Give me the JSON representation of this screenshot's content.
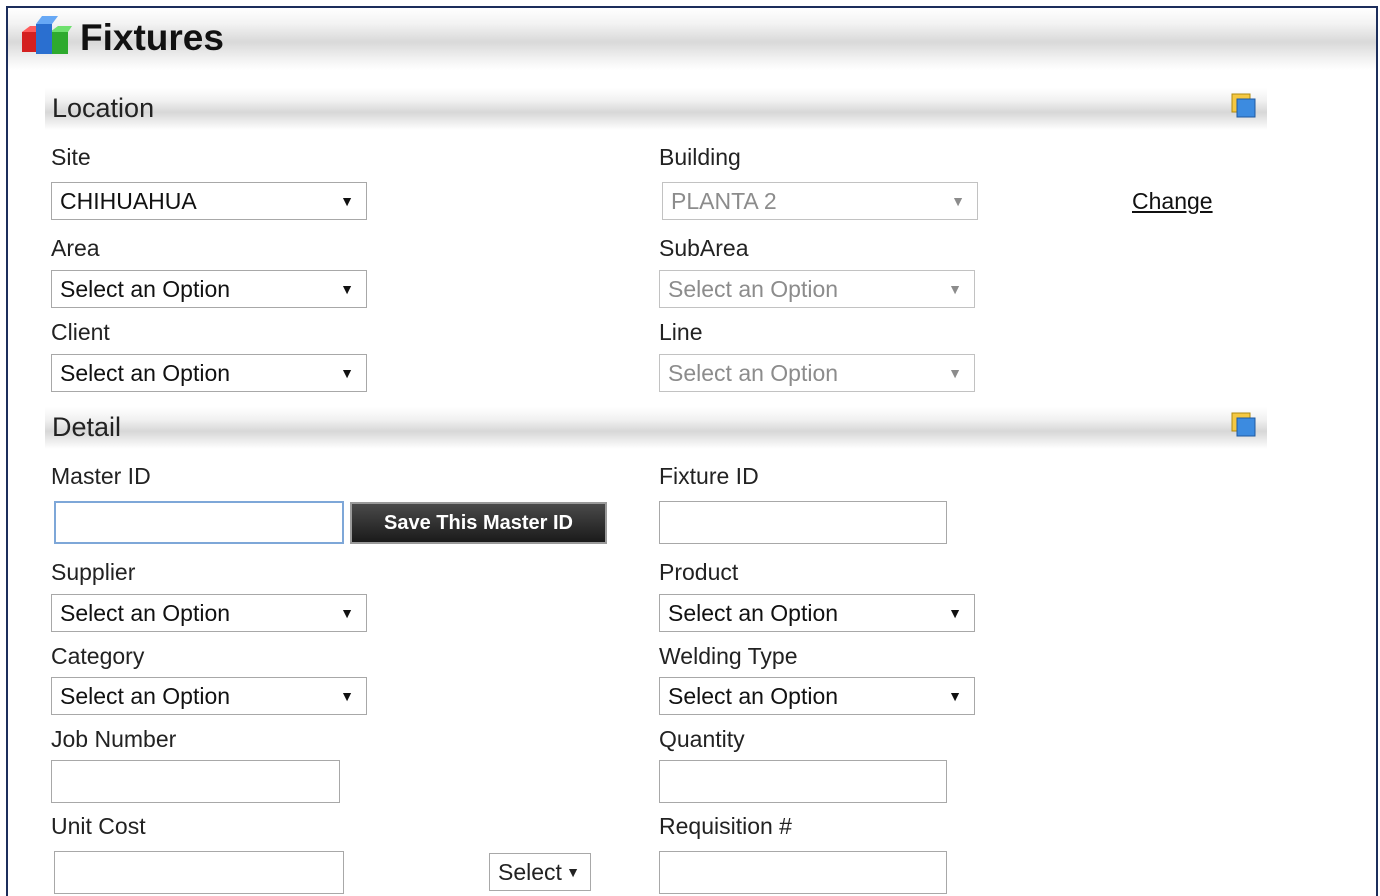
{
  "header": {
    "title": "Fixtures",
    "logo_icon": "cubes-icon"
  },
  "location": {
    "title": "Location",
    "site": {
      "label": "Site",
      "value": "CHIHUAHUA"
    },
    "building": {
      "label": "Building",
      "value": "PLANTA 2"
    },
    "change_link": "Change",
    "area": {
      "label": "Area",
      "value": "Select an Option"
    },
    "subarea": {
      "label": "SubArea",
      "value": "Select an Option"
    },
    "client": {
      "label": "Client",
      "value": "Select an Option"
    },
    "line": {
      "label": "Line",
      "value": "Select an Option"
    }
  },
  "detail": {
    "title": "Detail",
    "master_id": {
      "label": "Master ID",
      "value": ""
    },
    "save_master_button": "Save This Master ID",
    "fixture_id": {
      "label": "Fixture ID",
      "value": ""
    },
    "supplier": {
      "label": "Supplier",
      "value": "Select an Option"
    },
    "product": {
      "label": "Product",
      "value": "Select an Option"
    },
    "category": {
      "label": "Category",
      "value": "Select an Option"
    },
    "welding_type": {
      "label": "Welding Type",
      "value": "Select an Option"
    },
    "job_number": {
      "label": "Job Number",
      "value": ""
    },
    "quantity": {
      "label": "Quantity",
      "value": ""
    },
    "unit_cost": {
      "label": "Unit Cost",
      "value": ""
    },
    "currency_select": "Select",
    "requisition": {
      "label": "Requisition #",
      "value": ""
    }
  },
  "colors": {
    "frame": "#1c2e5c",
    "button_bg": "#222222",
    "focus_border": "#7ea7d8"
  }
}
